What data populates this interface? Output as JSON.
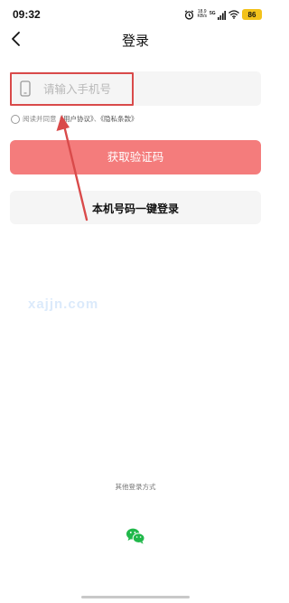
{
  "status_bar": {
    "time": "09:32",
    "net_speed_value": "18.9",
    "net_speed_unit": "KB/s",
    "network": "5G",
    "battery": "86",
    "battery_color": "#f3c21b"
  },
  "header": {
    "title": "登录",
    "back_icon": "back-chevron-icon"
  },
  "login_form": {
    "phone_placeholder": "请输入手机号",
    "phone_value": "",
    "phone_icon": "phone-icon",
    "agreement_prefix": "阅读并同意",
    "user_agreement": "《用户协议》",
    "separator": "、",
    "privacy_policy": "《隐私条款》",
    "agreement_checked": false,
    "get_code_label": "获取验证码",
    "one_click_label": "本机号码一键登录"
  },
  "watermark": "xajjn.com",
  "other_login": {
    "label": "其他登录方式",
    "wechat_icon": "wechat-icon"
  },
  "colors": {
    "primary_button": "#f47c7c",
    "highlight_box": "#d94a4a",
    "field_background": "#f5f5f5",
    "wechat_green": "#20b84a"
  }
}
